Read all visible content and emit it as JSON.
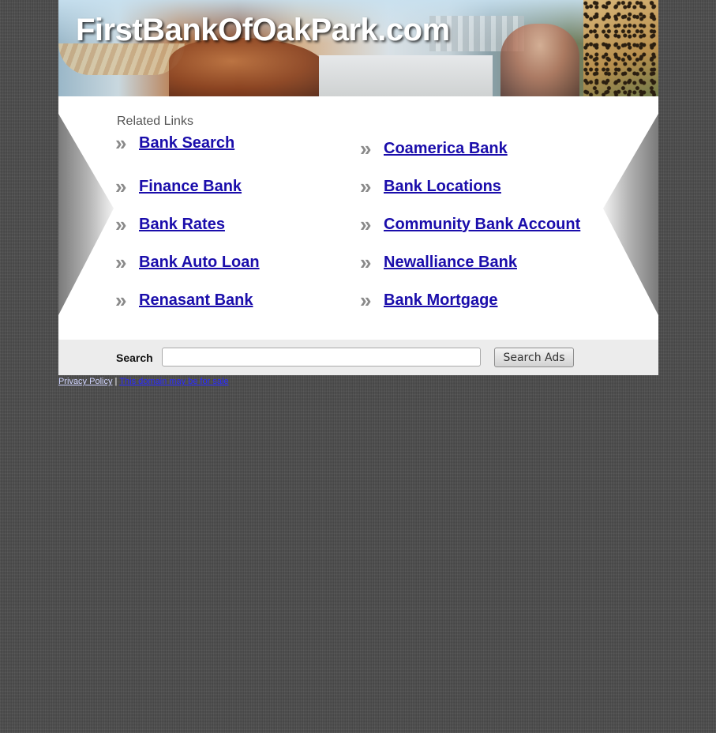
{
  "header": {
    "site_title": "FirstBankOfOakPark.com"
  },
  "related": {
    "heading": "Related Links",
    "links": [
      {
        "label": "Bank Search"
      },
      {
        "label": "Coamerica Bank"
      },
      {
        "label": "Finance Bank"
      },
      {
        "label": "Bank Locations"
      },
      {
        "label": "Bank Rates"
      },
      {
        "label": "Community Bank Account"
      },
      {
        "label": "Bank Auto Loan"
      },
      {
        "label": "Newalliance Bank"
      },
      {
        "label": "Renasant Bank"
      },
      {
        "label": "Bank Mortgage"
      }
    ],
    "bullet_icon": "double-chevron-right-icon"
  },
  "search": {
    "label": "Search",
    "input_value": "",
    "button_label": "Search Ads"
  },
  "footer": {
    "privacy_label": "Privacy Policy",
    "separator": "|",
    "for_sale_label": "This domain may be for sale"
  },
  "colors": {
    "link": "#1a0dab",
    "background": "#4a4a4a",
    "panel": "#ffffff",
    "search_bar": "#ececec"
  }
}
